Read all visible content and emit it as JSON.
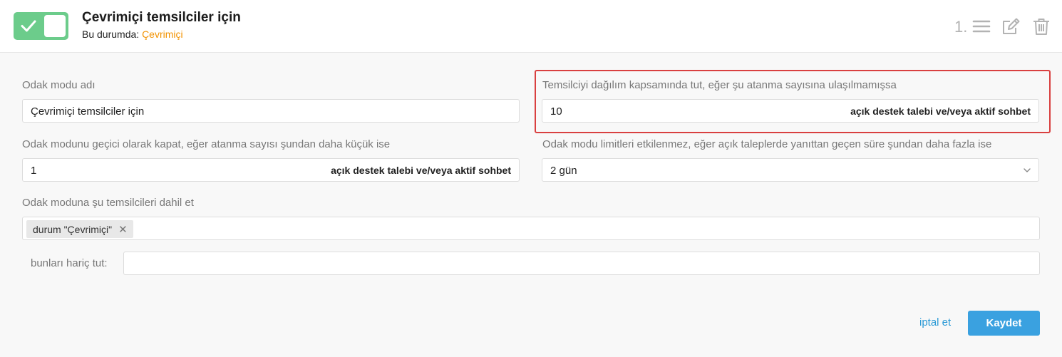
{
  "header": {
    "title": "Çevrimiçi temsilciler için",
    "status_prefix": "Bu durumda:",
    "status_value": "Çevrimiçi",
    "order": "1.",
    "toggle_on": true
  },
  "form": {
    "name": {
      "label": "Odak modu adı",
      "value": "Çevrimiçi temsilciler için"
    },
    "keep_in_distribution": {
      "label": "Temsilciyi dağılım kapsamında tut, eğer şu atanma sayısına ulaşılmamışsa",
      "value": "10",
      "suffix": "açık destek talebi ve/veya aktif sohbet"
    },
    "temp_disable": {
      "label": "Odak modunu geçici olarak kapat, eğer atanma sayısı şundan daha küçük ise",
      "value": "1",
      "suffix": "açık destek talebi ve/veya aktif sohbet"
    },
    "limits_unaffected": {
      "label": "Odak modu limitleri etkilenmez, eğer açık taleplerde yanıttan geçen süre şundan daha fazla ise",
      "selected": "2 gün"
    },
    "include_agents": {
      "label": "Odak moduna şu temsilcileri dahil et",
      "tags": [
        "durum \"Çevrimiçi\""
      ]
    },
    "exclude": {
      "label": "bunları hariç tut:",
      "value": ""
    }
  },
  "actions": {
    "cancel_label": "iptal et",
    "save_label": "Kaydet"
  },
  "colors": {
    "toggle": "#6ccc8b",
    "status": "#f29200",
    "primary": "#3aa1e0",
    "highlight": "#d94040"
  }
}
